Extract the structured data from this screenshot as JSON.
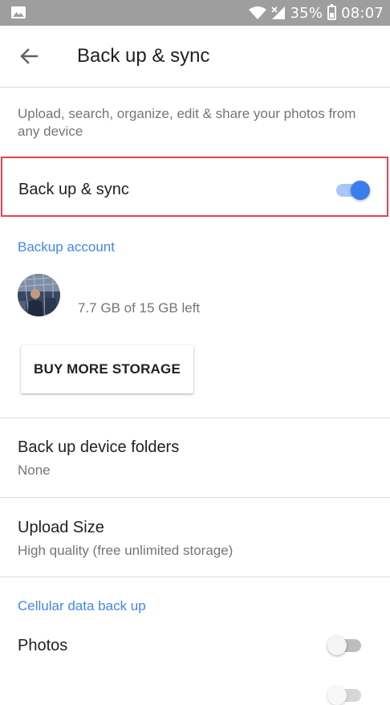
{
  "status_bar": {
    "battery": "35%",
    "time": "08:07"
  },
  "toolbar": {
    "title": "Back up & sync"
  },
  "description": "Upload, search, organize, edit & share your photos from any device",
  "backup_sync": {
    "label": "Back up & sync",
    "enabled": true
  },
  "backup_account": {
    "header": "Backup account",
    "storage": "7.7 GB of 15 GB left",
    "buy_button": "BUY MORE STORAGE"
  },
  "device_folders": {
    "title": "Back up device folders",
    "value": "None"
  },
  "upload_size": {
    "title": "Upload Size",
    "value": "High quality (free unlimited storage)"
  },
  "cellular": {
    "header": "Cellular data back up",
    "photos_label": "Photos",
    "photos_enabled": false
  },
  "colors": {
    "accent": "#4285f4",
    "status_bar": "#9e9e9e",
    "highlight": "#e8434f"
  }
}
